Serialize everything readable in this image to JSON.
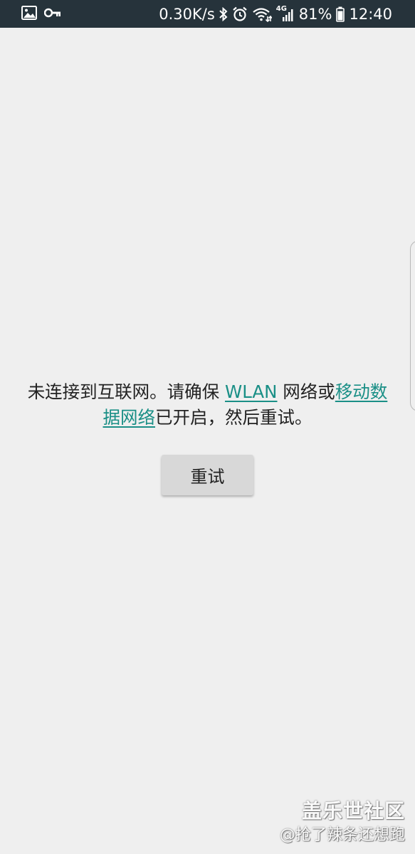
{
  "status_bar": {
    "network_speed": "0.30K/s",
    "network_type": "4G",
    "battery": "81%",
    "time": "12:40",
    "icons_left": [
      "image-icon",
      "key-icon"
    ],
    "icons_right": [
      "bluetooth-icon",
      "alarm-icon",
      "wifi-icon",
      "signal-icon",
      "battery-icon"
    ]
  },
  "main": {
    "message_part1": "未连接到互联网。请确保 ",
    "link_wlan": "WLAN",
    "message_part2": " 网络或",
    "link_mobile": "移动数据网络",
    "message_part3": "已开启，然后重试。",
    "retry_label": "重试",
    "link_color": "#1a8f86"
  },
  "watermark": {
    "title": "盖乐世社区",
    "subtitle": "@抢了辣条还想跑"
  }
}
